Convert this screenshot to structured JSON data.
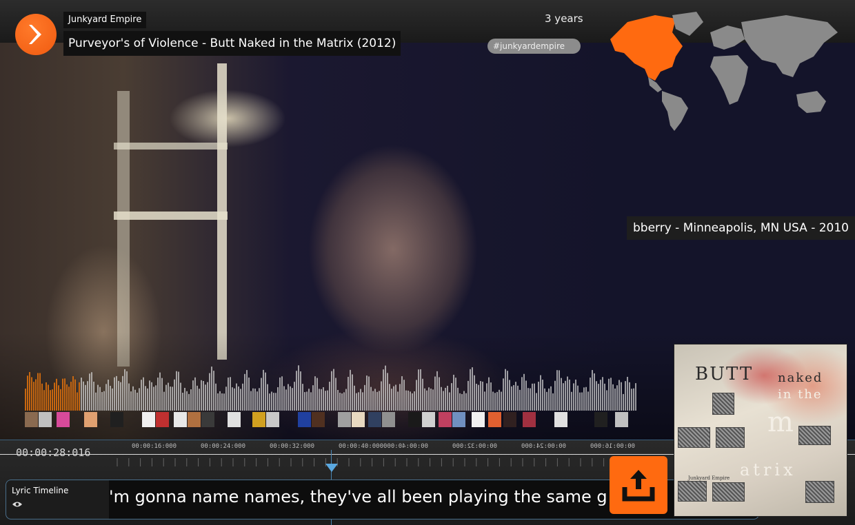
{
  "header": {
    "artist": "Junkyard Empire",
    "track_title": "Purveyor's of Violence - Butt Naked in the Matrix (2012)",
    "age": "3 years",
    "hashtag": "#junkyardempire"
  },
  "logo": {
    "icon": "play-arrow-icon",
    "color": "#ff6a10"
  },
  "location_caption": "bberry - Minneapolis, MN USA - 2010",
  "world_map": {
    "highlight_region": "North America",
    "highlight_color": "#ff6a10",
    "base_color": "#8a8a8a"
  },
  "waveform": {
    "played_color": "#d06a10",
    "unplayed_color": "#d9d9d9",
    "played_fraction": 0.09
  },
  "timeline": {
    "current_time": "00:00:28:016",
    "tick_labels": [
      "00:00:16:000",
      "00:00:24:000",
      "00:00:32:000",
      "00:00:40:000",
      "00:00:40:000",
      "00:00:32:000",
      "00:00:24:000",
      "00:00:16:000"
    ],
    "playhead_color": "#5aa8e0"
  },
  "lyric_panel": {
    "label": "Lyric Timeline",
    "icon": "eye-icon",
    "lyric": "'m gonna name names, they've all been playing the same g"
  },
  "upload_button": {
    "icon": "upload-icon",
    "color": "#ff6a10"
  },
  "album_art": {
    "word_1": "BUTT",
    "word_2": "naked",
    "word_3": "in the",
    "word_4": "m",
    "word_5": "atrix",
    "small_caption": "Junkyard Empire"
  }
}
